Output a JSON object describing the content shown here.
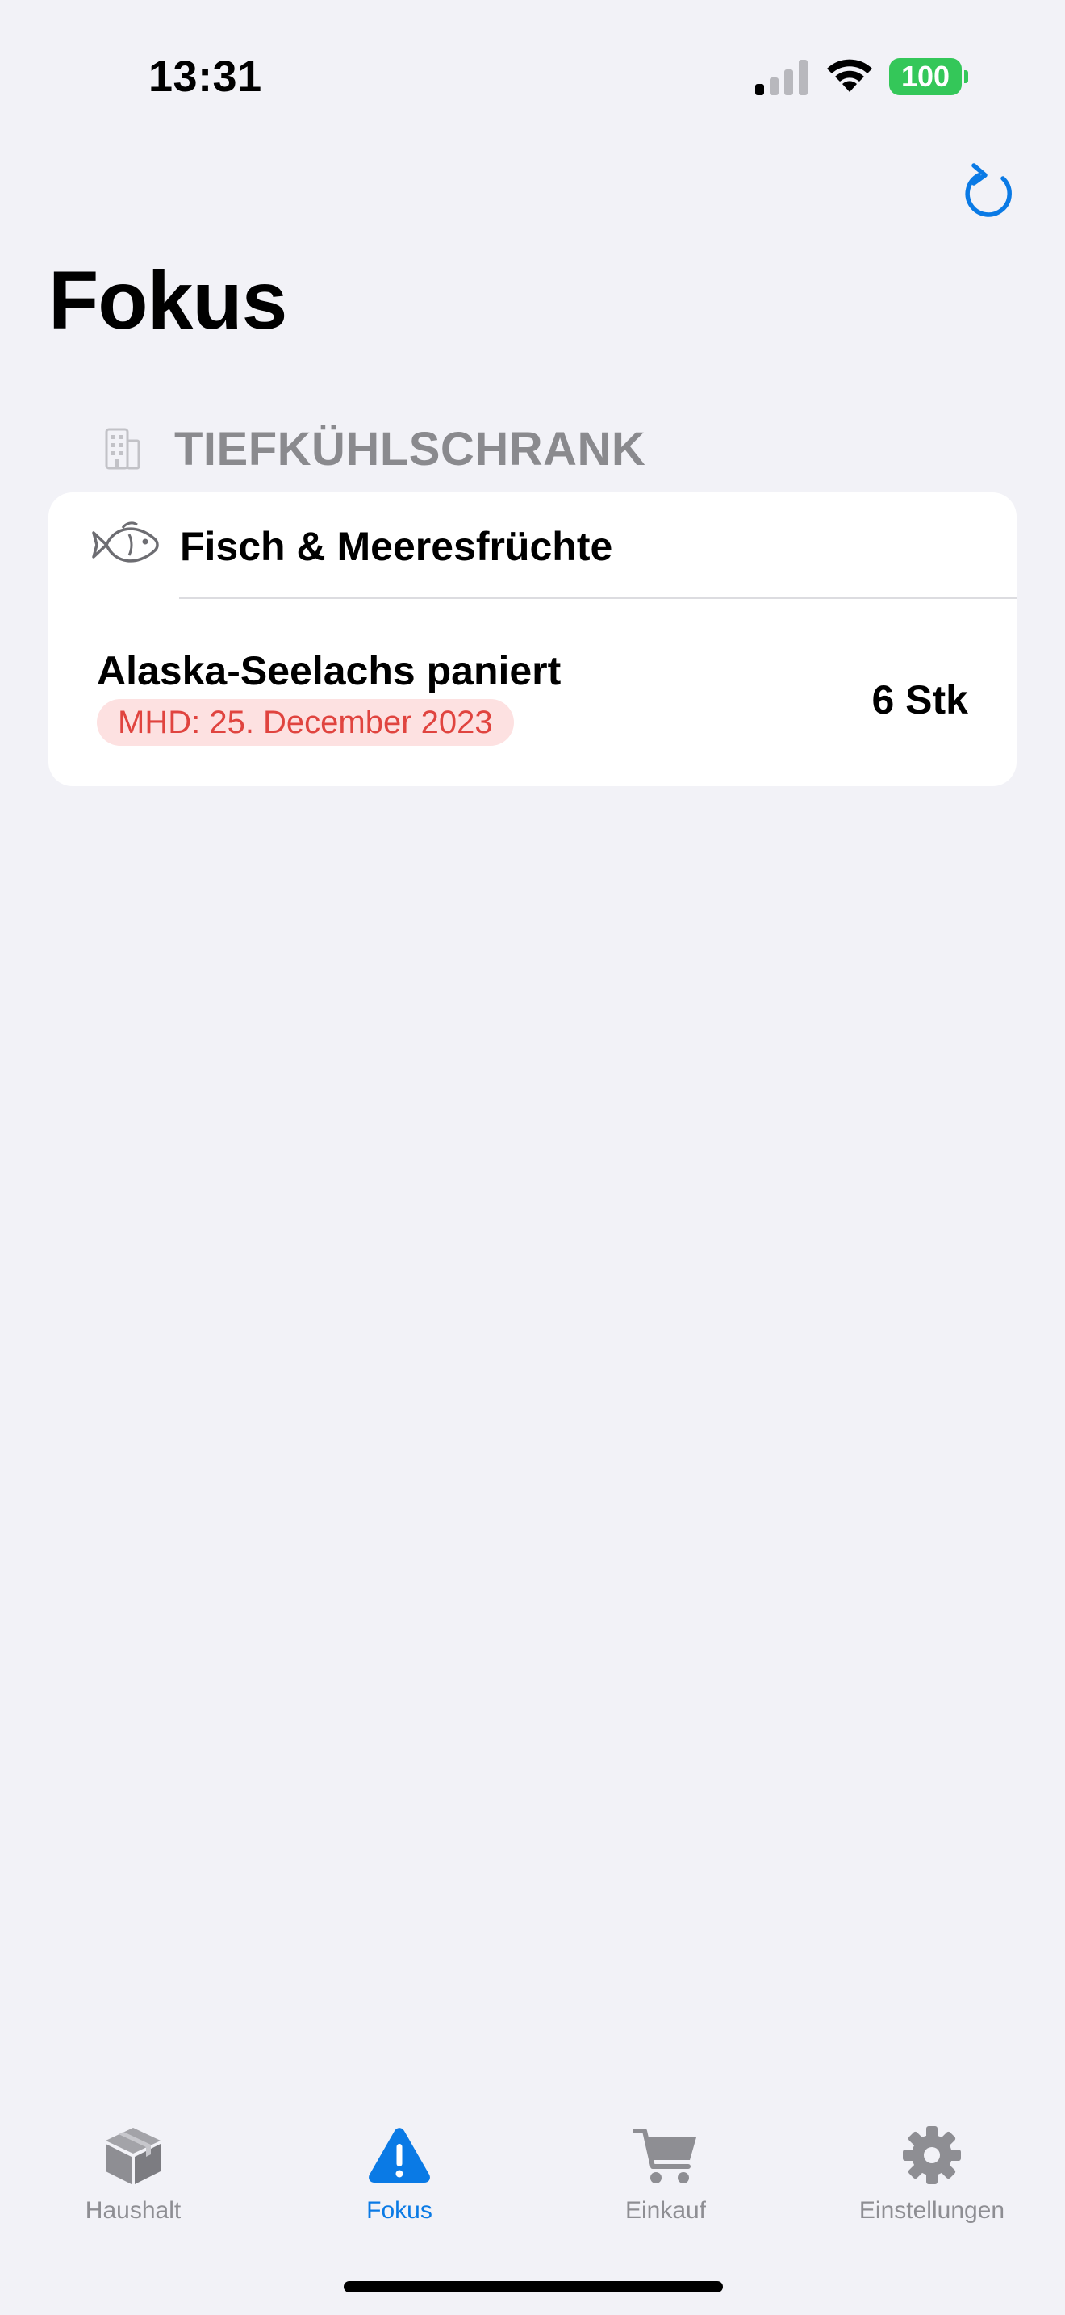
{
  "status_bar": {
    "time": "13:31",
    "battery_level": "100",
    "icons": [
      "signal-icon",
      "wifi-icon",
      "battery-icon"
    ]
  },
  "header": {
    "refresh_icon": "refresh-icon",
    "title": "Fokus"
  },
  "section": {
    "icon": "building-icon",
    "title": "TIEFKÜHLSCHRANK"
  },
  "category": {
    "icon": "fish-icon",
    "label": "Fisch & Meeresfrüchte"
  },
  "items": [
    {
      "name": "Alaska-Seelachs paniert",
      "expiry": "MHD: 25. December 2023",
      "quantity": "6 Stk"
    }
  ],
  "tab_bar": {
    "tabs": [
      {
        "label": "Haushalt",
        "icon": "box-icon",
        "active": false
      },
      {
        "label": "Fokus",
        "icon": "warning-icon",
        "active": true
      },
      {
        "label": "Einkauf",
        "icon": "cart-icon",
        "active": false
      },
      {
        "label": "Einstellungen",
        "icon": "gear-icon",
        "active": false
      }
    ]
  },
  "colors": {
    "accent": "#0a7ae5",
    "expired_text": "#e0443f",
    "expired_background": "#fde1e1",
    "battery": "#34c759",
    "background": "#f2f2f7"
  }
}
